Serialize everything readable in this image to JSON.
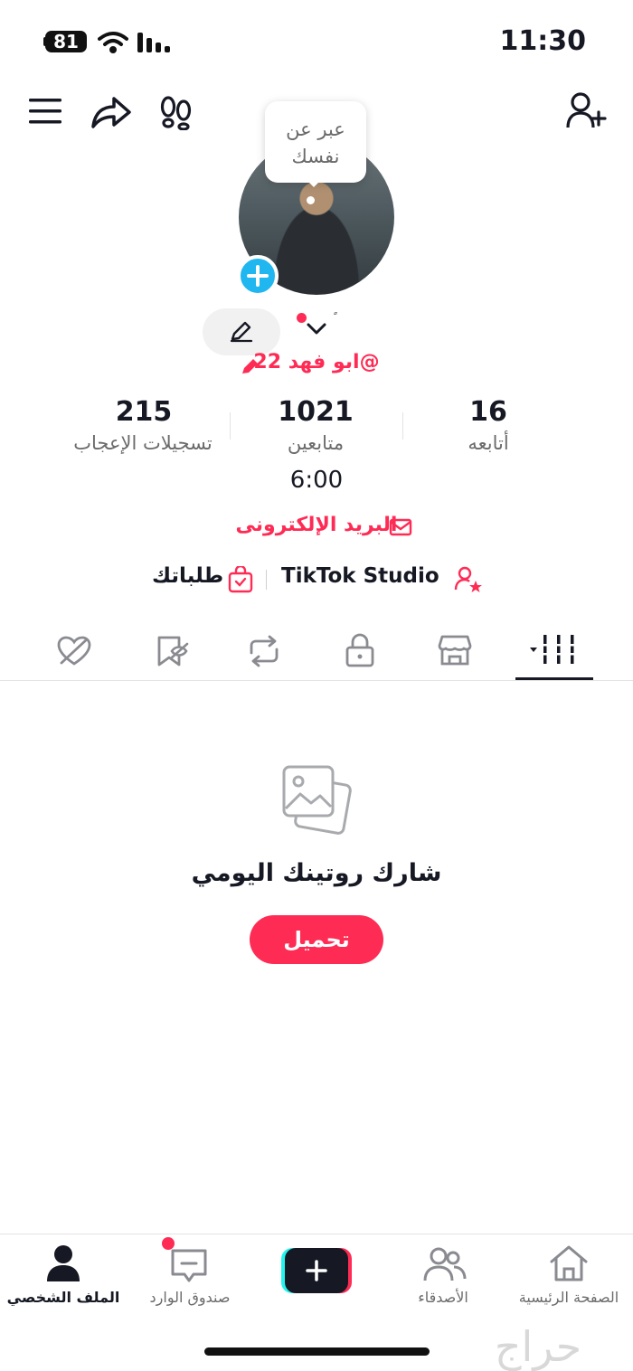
{
  "status_bar": {
    "battery": "81",
    "time": "11:30"
  },
  "profile": {
    "bubble_text": "عبر عن نفسك",
    "username": "@ابو فهد 22"
  },
  "stats": [
    {
      "value": "215",
      "label": "تسجيلات الإعجاب"
    },
    {
      "value": "1021",
      "label": "متابعين"
    },
    {
      "value": "16",
      "label": "أتابعه"
    }
  ],
  "bio": "6:00",
  "email_label": "البريد الإلكترونى",
  "links": {
    "studio": "TikTok Studio",
    "orders": "طلباتك"
  },
  "empty_state": {
    "title": "شارك روتينك اليومي",
    "button": "تحميل"
  },
  "bottom_nav": {
    "profile": "الملف الشخصي",
    "inbox": "صندوق الوارد",
    "friends": "الأصدقاء",
    "home": "الصفحة الرئيسية"
  },
  "watermark": "حراج",
  "colors": {
    "accent": "#fe2c55",
    "badge": "#20b6ef",
    "text": "#161823",
    "muted": "#6b6b6b"
  }
}
